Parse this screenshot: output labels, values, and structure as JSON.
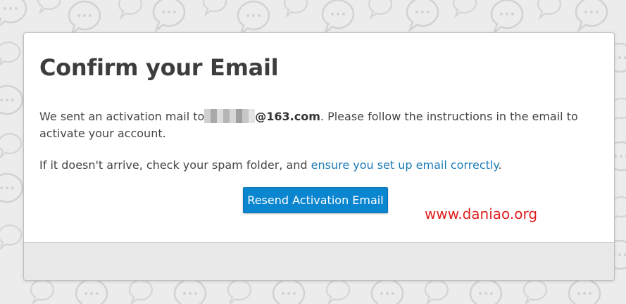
{
  "modal": {
    "title": "Confirm your Email",
    "message_prefix": "We sent an activation mail to",
    "email_domain": "@163.com",
    "message_suffix": ". Please follow the instructions in the email to activate your account.",
    "spam_prefix": "If it doesn't arrive, check your spam folder, and ",
    "spam_link": "ensure you set up email correctly",
    "spam_suffix": ".",
    "resend_button": "Resend Activation Email"
  },
  "watermark": {
    "text": "www.daniao.org",
    "color": "#e02020"
  },
  "colors": {
    "button": "#0a86d0",
    "link": "#1a7ab5",
    "title": "#3d3d3d",
    "footer": "#e8e8e8"
  },
  "background": {
    "pattern": "speech-bubble-icon"
  }
}
